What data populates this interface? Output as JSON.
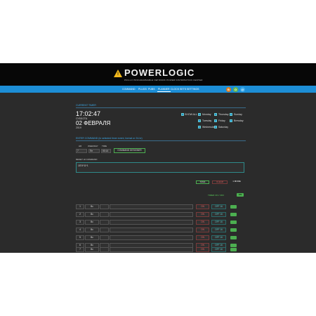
{
  "logo": {
    "name": "POWERLOGIC",
    "tagline": "PDU-LX PROGRAMMABLE NETWORK POWER DISTRIBUTION CENTER",
    "mark": "!"
  },
  "nav": {
    "items": [
      "COMMAND",
      "PLUGS",
      "PUBS",
      "PLANNER",
      "CLOCK SETS",
      "SETTINGS"
    ],
    "active_index": 3
  },
  "social": [
    {
      "icon": "vk-icon",
      "glyph": "B",
      "color": "#e07b1a"
    },
    {
      "icon": "odnoklassniki-icon",
      "glyph": "O",
      "color": "#66b74a"
    },
    {
      "icon": "globe-icon",
      "glyph": "@",
      "color": "#3aa8e8"
    }
  ],
  "clock_section": {
    "title": "CURRENT TIMER",
    "time": "17:02:47",
    "weekday": "СУББОТА",
    "date": "02 ФЕВРАЛЯ",
    "year": "2019"
  },
  "days": {
    "show_all": "SHOW ALL",
    "items": [
      "Monday",
      "Tuesday",
      "Wednesday",
      "Thursday",
      "Friday",
      "Saturday",
      "Sunday",
      "Brewday"
    ]
  },
  "command_section": {
    "title": "ENTER COMMAND (in selected timer event, format or 24-hr)",
    "labels": {
      "hr": "HR",
      "weekday": "WEEKDAY",
      "time": "TIME"
    },
    "values": {
      "hr": "7",
      "weekday": "Пн",
      "time": "00:14"
    },
    "designer_button": "COMMAND DESIGNER",
    "reset_label": "RESET HI COMMAND",
    "command_text": "1874*11*1",
    "save_button": "SAVE",
    "clear_button": "CLEAR",
    "more_label": "1 MORE"
  },
  "timer_list": {
    "label": "TIMER ON / OFF",
    "toggle_text": "ON",
    "rows": [
      {
        "n": "1",
        "type": "Вс",
        "on": "ON",
        "off": "OFF 16"
      },
      {
        "n": "2",
        "type": "Вс",
        "on": "ON",
        "off": "OFF 16"
      },
      {
        "n": "3",
        "type": "Вс",
        "on": "ON",
        "off": "OFF 16"
      },
      {
        "n": "4",
        "type": "Вс",
        "on": "ON",
        "off": "OFF 16"
      },
      {
        "n": "5",
        "type": "Вс",
        "on": "ON",
        "off": "OFF 16"
      },
      {
        "n": "6",
        "type": "Вс",
        "on": "ON",
        "off": "OFF 16"
      },
      {
        "n": "7",
        "type": "Вс",
        "on": "ON",
        "off": "OFF 16"
      }
    ]
  }
}
